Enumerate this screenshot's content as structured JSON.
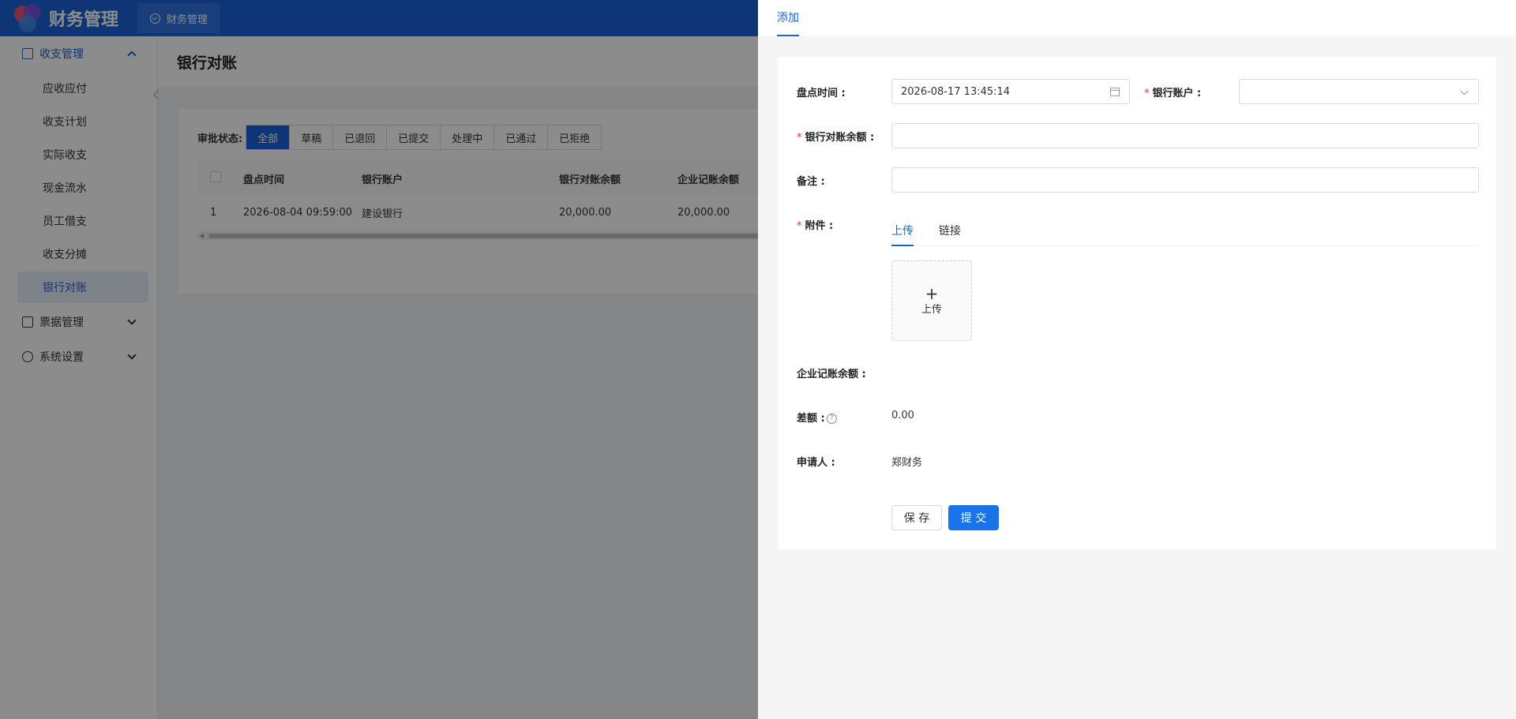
{
  "app": {
    "title": "财务管理",
    "top_tab": "财务管理"
  },
  "sidebar": {
    "groups": [
      {
        "label": "收支管理",
        "icon": "ledger-icon",
        "expanded": true
      },
      {
        "label": "票据管理",
        "icon": "receipt-icon",
        "expanded": false
      },
      {
        "label": "系统设置",
        "icon": "gear-icon",
        "expanded": false
      }
    ],
    "items": [
      "应收应付",
      "收支计划",
      "实际收支",
      "现金流水",
      "员工借支",
      "收支分摊",
      "银行对账"
    ],
    "active_item": "银行对账"
  },
  "page": {
    "title": "银行对账"
  },
  "filter": {
    "label": "审批状态:",
    "options": [
      "全部",
      "草稿",
      "已退回",
      "已提交",
      "处理中",
      "已通过",
      "已拒绝"
    ],
    "selected": "全部"
  },
  "table": {
    "columns": [
      "盘点时间",
      "银行账户",
      "银行对账余额",
      "企业记账余额"
    ],
    "rows": [
      {
        "index": "1",
        "time": "2026-08-04 09:59:00",
        "account": "建设银行",
        "bank_balance": "20,000.00",
        "company_balance": "20,000.00"
      }
    ]
  },
  "drawer": {
    "tab": "添加",
    "form": {
      "time_label": "盘点时间 :",
      "time_value": "2026-08-17 13:45:14",
      "account_label": "银行账户 :",
      "account_value": "",
      "bank_balance_label": "银行对账余额 :",
      "remark_label": "备注 :",
      "attachment_label": "附件 :",
      "attachment_tabs": [
        "上传",
        "链接"
      ],
      "upload_text": "上传",
      "company_balance_label": "企业记账余额 :",
      "diff_label": "差额 :",
      "diff_value": "0.00",
      "applicant_label": "申请人 :",
      "applicant_value": "郑财务",
      "save_label": "保 存",
      "submit_label": "提 交"
    }
  },
  "colors": {
    "primary": "#1a62d6",
    "required": "#e53935"
  }
}
